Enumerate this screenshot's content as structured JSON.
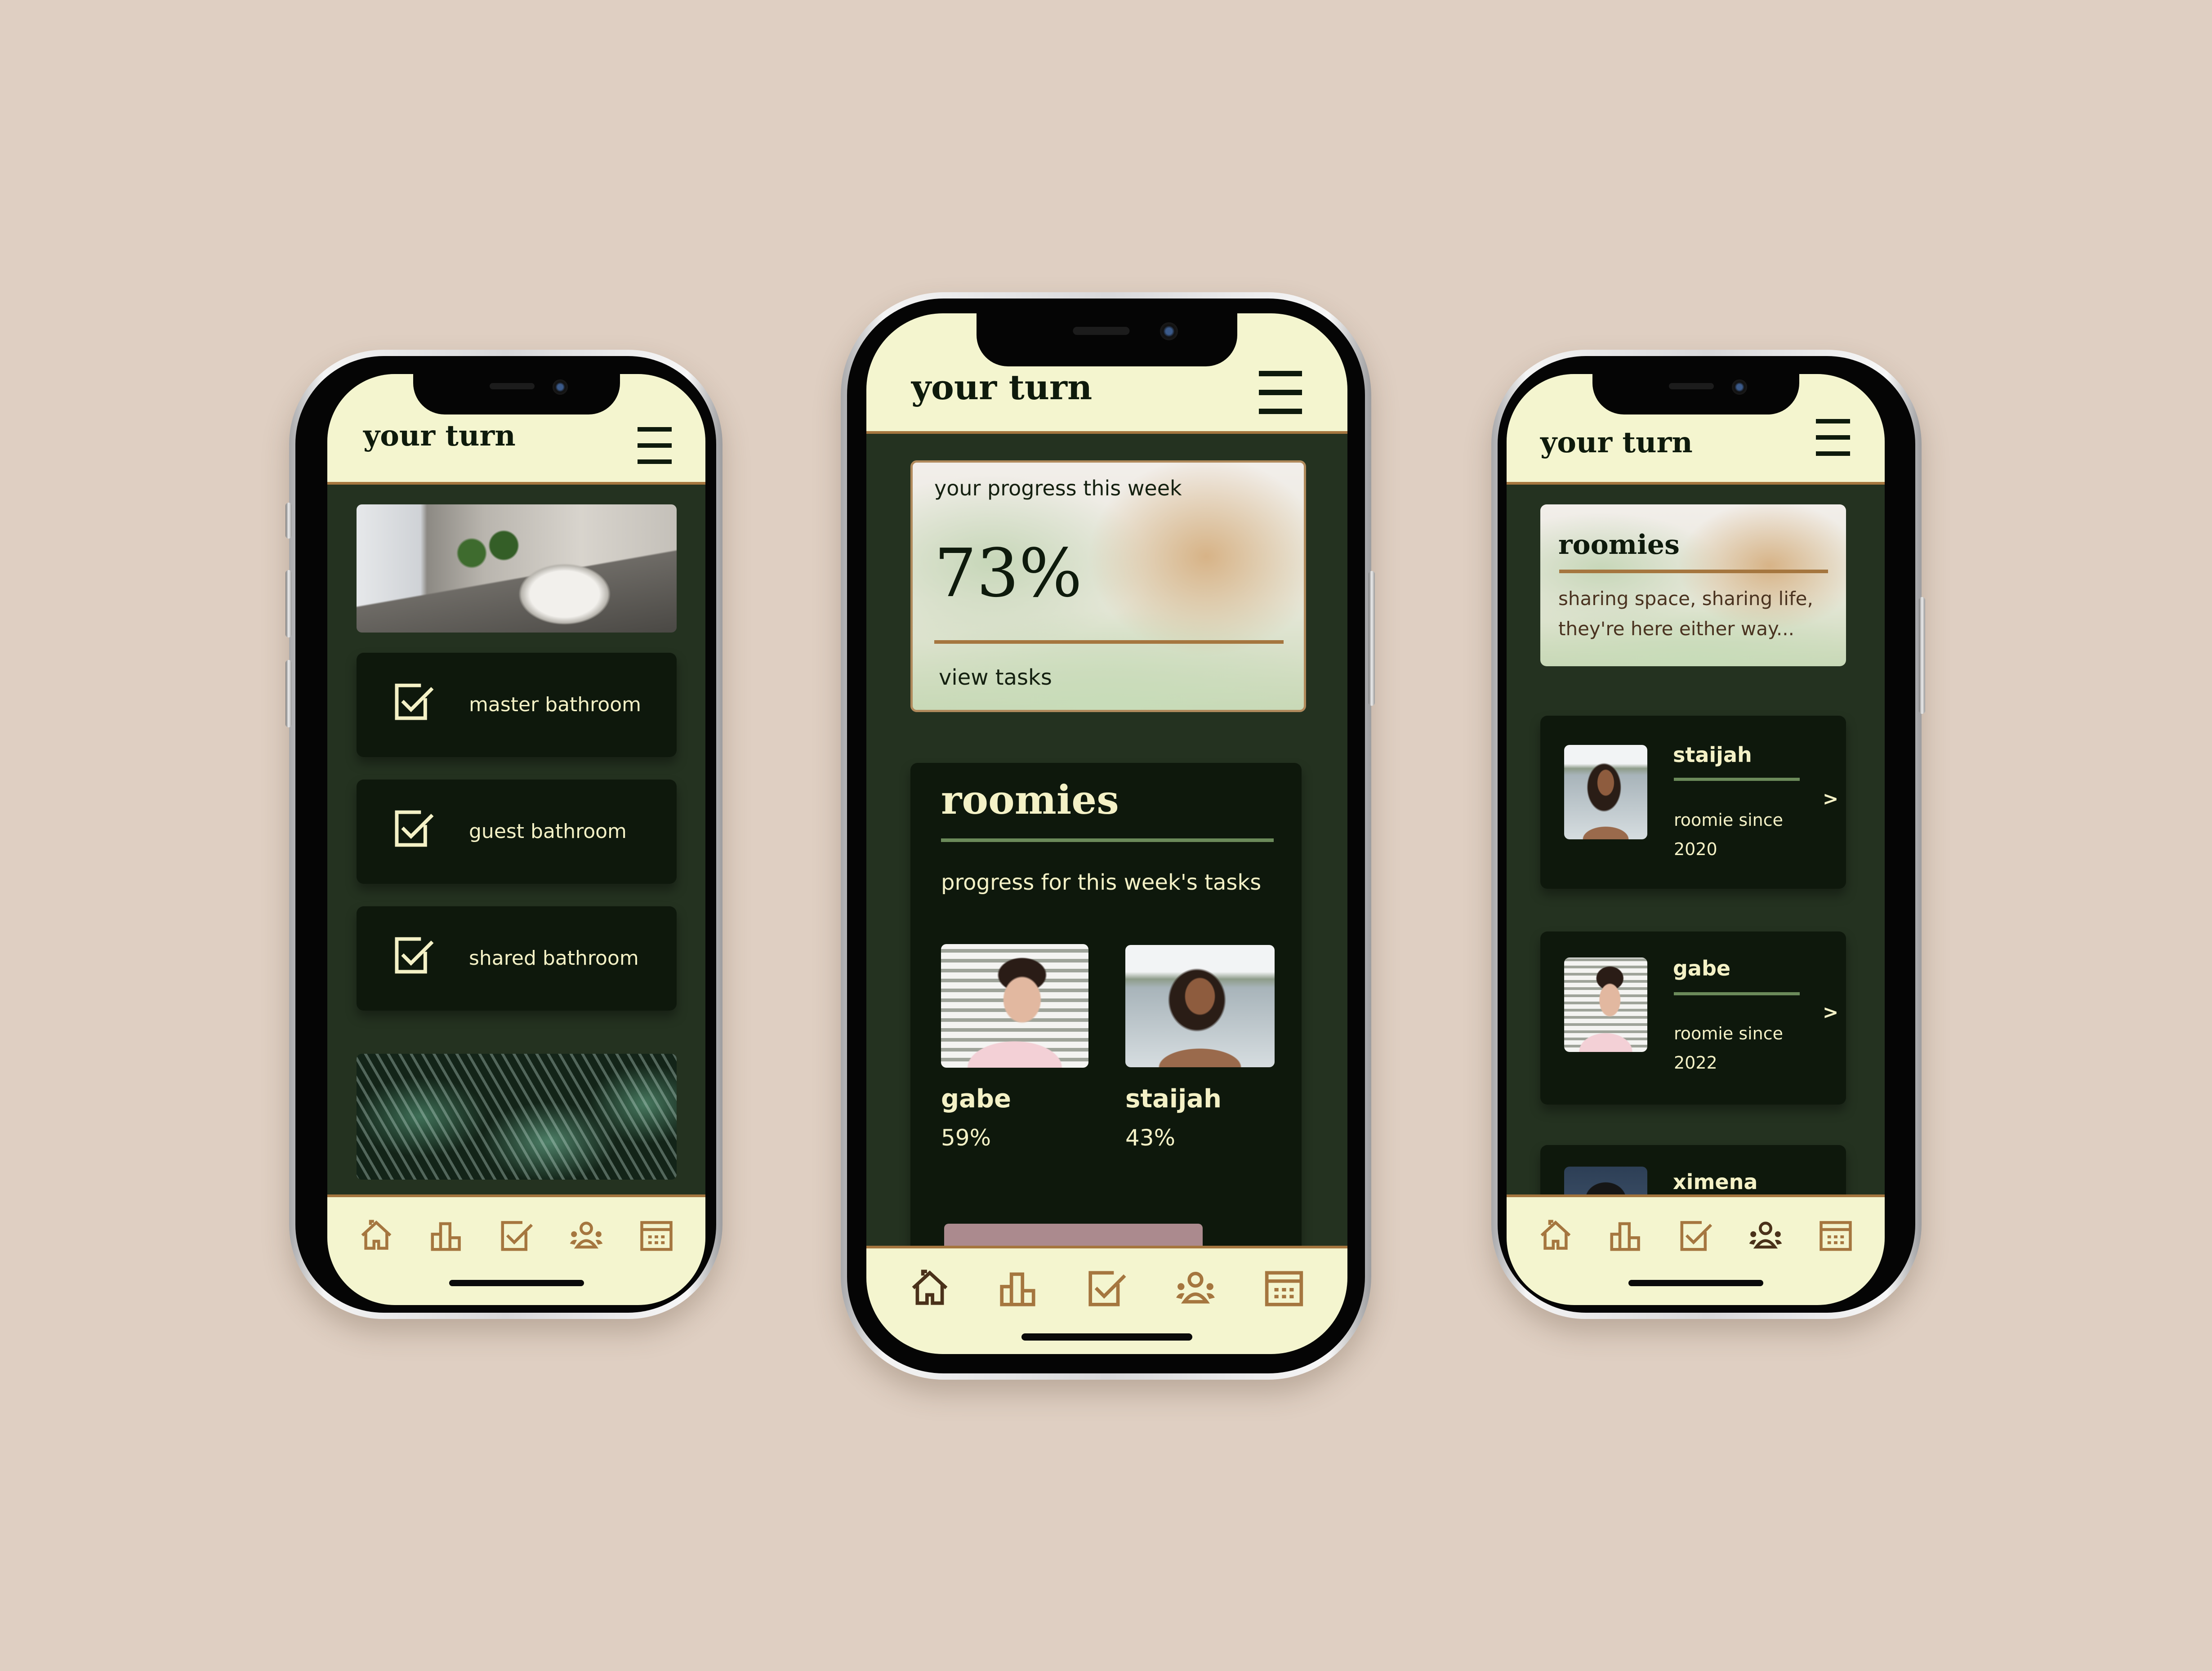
{
  "app": {
    "title": "your turn"
  },
  "colors": {
    "background": "#dfcfc2",
    "header_bg": "#f4f5cf",
    "screen_bg": "#243220",
    "card_bg": "#0e180c",
    "accent_brown": "#a5763f",
    "accent_green": "#6b8a5a",
    "text_cream": "#f4f1c6",
    "text_dark": "#0e1a0c",
    "pink_button": "#ab8a8e"
  },
  "nav_icons": [
    "home-icon",
    "bar-chart-icon",
    "checkbox-icon",
    "people-icon",
    "calendar-icon"
  ],
  "left_phone": {
    "header_title": "your turn",
    "hero_image": "bathroom-sink-photo",
    "tasks": [
      {
        "label": "master bathroom",
        "checked": true
      },
      {
        "label": "guest bathroom",
        "checked": true
      },
      {
        "label": "shared bathroom",
        "checked": true
      }
    ],
    "footer_image": "leaves-photo",
    "active_nav": "checkbox-icon"
  },
  "center_phone": {
    "header_title": "your turn",
    "progress_card": {
      "label": "your progress this week",
      "value": "73%",
      "link": "view tasks"
    },
    "roomies_card": {
      "title": "roomies",
      "subtitle": "progress for this week's tasks",
      "members": [
        {
          "name": "gabe",
          "progress": "59%"
        },
        {
          "name": "staijah",
          "progress": "43%"
        }
      ]
    },
    "active_nav": "home-icon"
  },
  "right_phone": {
    "header_title": "your turn",
    "intro_card": {
      "title": "roomies",
      "text_line1": "sharing space, sharing life,",
      "text_line2": "they're here either way..."
    },
    "roomies": [
      {
        "name": "staijah",
        "since_label": "roomie since",
        "year": "2020",
        "chevron": ">"
      },
      {
        "name": "gabe",
        "since_label": "roomie since",
        "year": "2022",
        "chevron": ">"
      },
      {
        "name": "ximena",
        "since_label": "",
        "year": "",
        "chevron": ""
      }
    ],
    "active_nav": "people-icon"
  }
}
